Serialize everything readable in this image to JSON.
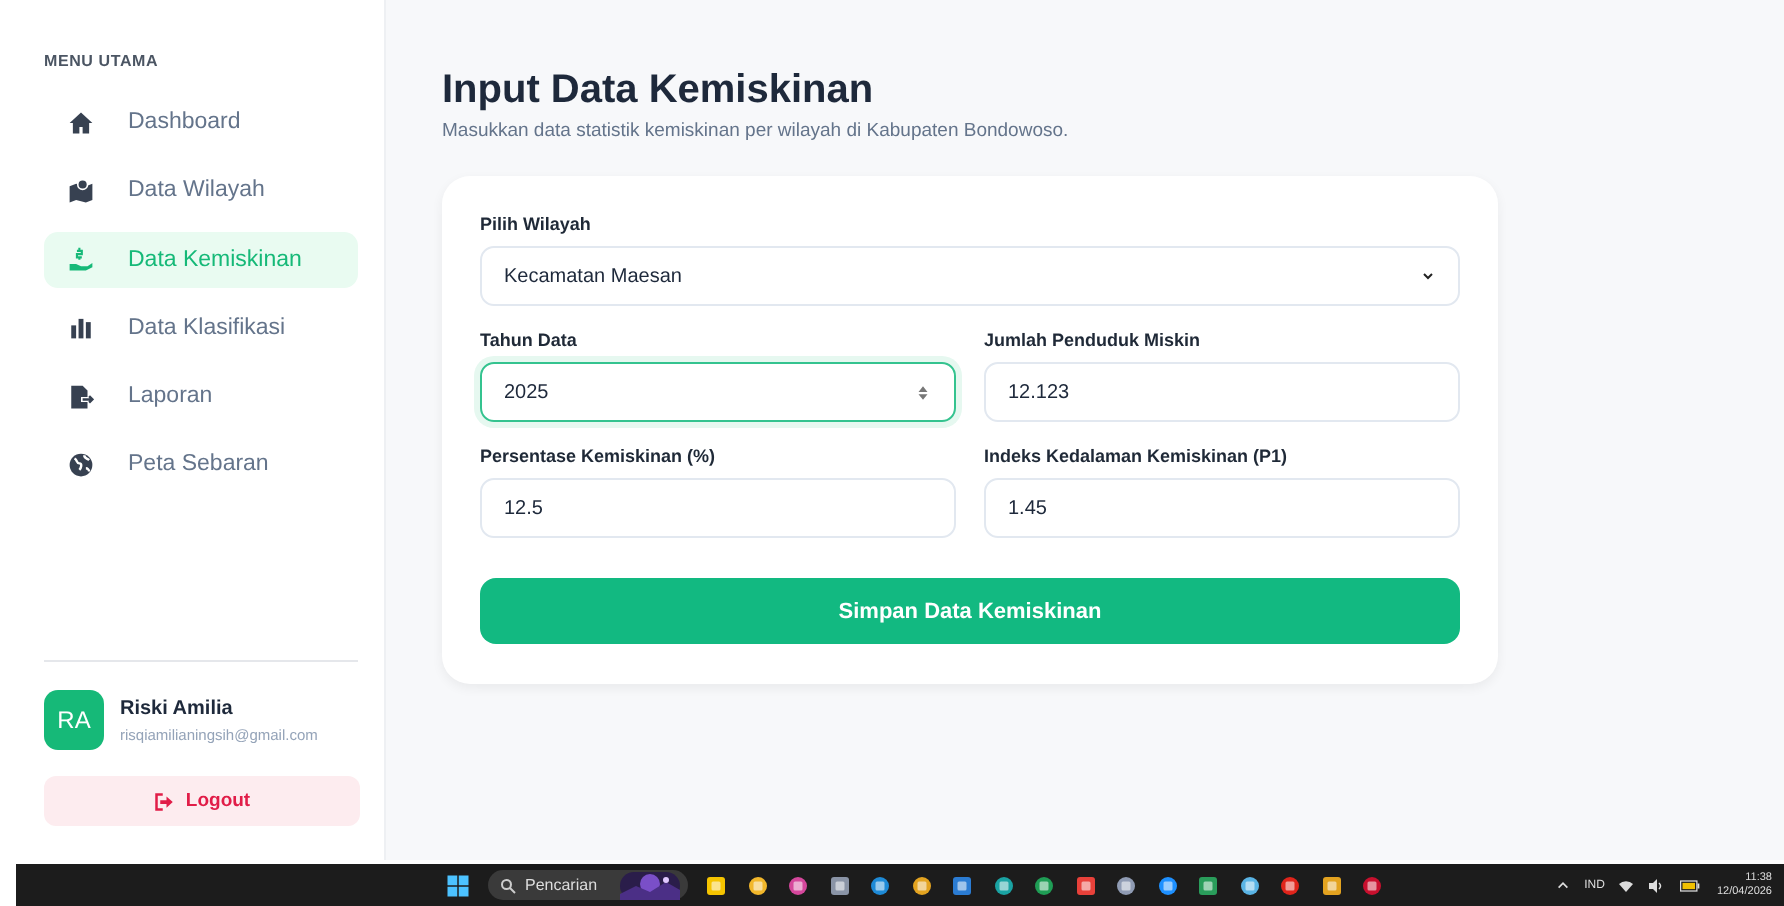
{
  "sidebar": {
    "heading": "MENU UTAMA",
    "items": [
      {
        "label": "Dashboard",
        "selected": false
      },
      {
        "label": "Data Wilayah",
        "selected": false
      },
      {
        "label": "Data Kemiskinan",
        "selected": true
      },
      {
        "label": "Data Klasifikasi",
        "selected": false
      },
      {
        "label": "Laporan",
        "selected": false
      },
      {
        "label": "Peta Sebaran",
        "selected": false
      }
    ],
    "user": {
      "initials": "RA",
      "name": "Riski Amilia",
      "email": "risqiamilianingsih@gmail.com"
    },
    "logout": "Logout"
  },
  "page": {
    "title": "Input Data Kemiskinan",
    "subtitle": "Masukkan data statistik kemiskinan per wilayah di Kabupaten Bondowoso."
  },
  "form": {
    "fields": [
      {
        "label": "Pilih Wilayah",
        "value": "Kecamatan Maesan",
        "kind": "select",
        "focused": false
      },
      {
        "label": "Tahun Data",
        "value": "2025",
        "kind": "number",
        "focused": true
      },
      {
        "label": "Jumlah Penduduk Miskin",
        "value": "12.123",
        "kind": "text",
        "focused": false
      },
      {
        "label": "Persentase Kemiskinan (%)",
        "value": "12.5",
        "kind": "text",
        "focused": false
      },
      {
        "label": "Indeks Kedalaman Kemiskinan (P1)",
        "value": "1.45",
        "kind": "text",
        "focused": false
      }
    ],
    "submit": "Simpan Data Kemiskinan"
  },
  "taskbar": {
    "search": "Pencarian",
    "language": "IND",
    "time": "11:38",
    "date": "12/04/2026"
  }
}
